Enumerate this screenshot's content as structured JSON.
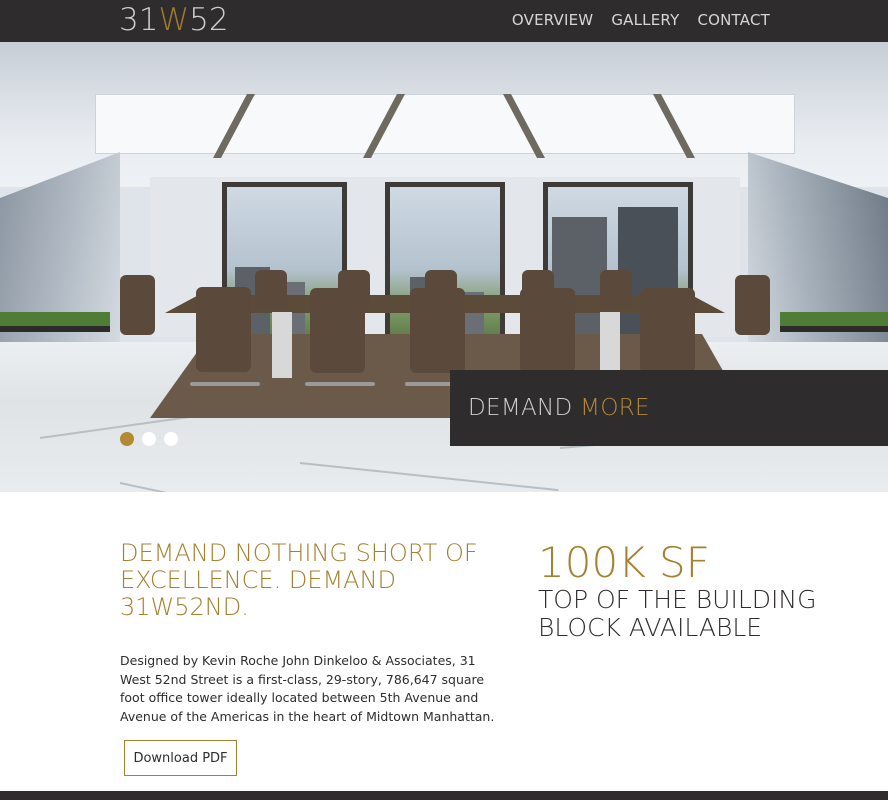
{
  "brand": {
    "logo_prefix": "31",
    "logo_mid": "W",
    "logo_suffix": "52",
    "gold": "#a6802f",
    "dark": "#2f2c2d"
  },
  "nav": {
    "items": [
      {
        "label": "OVERVIEW"
      },
      {
        "label": "GALLERY"
      },
      {
        "label": "CONTACT"
      }
    ]
  },
  "hero": {
    "image_alt": "conference-room-photo",
    "panel_word1": "DEMAND",
    "panel_word2": "MORE",
    "slides": {
      "count": 3,
      "active_index": 0
    }
  },
  "content": {
    "headline": "DEMAND NOTHING SHORT OF EXCELLENCE. DEMAND 31W52ND.",
    "body": "Designed by Kevin Roche John Dinkeloo & Associates, 31 West 52nd Street is a first-class, 29-story, 786,647 square foot office tower ideally located between 5th Avenue and Avenue of the Americas in the heart of Midtown Manhattan.",
    "download_label": "Download PDF",
    "stat_value": "100K SF",
    "stat_desc": "TOP OF THE BUILDING BLOCK AVAILABLE"
  }
}
